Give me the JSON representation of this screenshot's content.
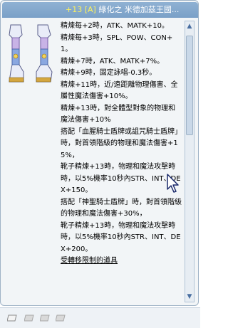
{
  "title": {
    "prefix": "+13 [A] ",
    "name": "綠化之 米德加茲王國..."
  },
  "description": [
    "精煉每+2時，ATK、MATK+10。",
    "精煉每+3時，SPL、POW、CON+1。",
    "精煉+7時，ATK、MATK+7%。",
    "精煉+9時，固定詠唱-0.3秒。",
    "精煉+11時，近/遠距離物理傷害、全屬性魔法傷害+10%。",
    "精煉+13時，對全體型對象的物理和魔法傷害+10%",
    "搭配「血腥騎士盾牌或詛咒騎士盾牌」時，對首領階級的物理和魔法傷害+15%，",
    "靴子精煉+13時，物理和魔法攻擊時時，以5%機率10秒內STR、INT、DEX+150。",
    "搭配「神聖騎士盾牌」時，對首領階級的物理和魔法傷害+30%，",
    "靴子精煉+13時，物理和魔法攻擊時時，以5%機率10秒內STR、INT、DEX+200。"
  ],
  "restriction": "受轉移限制的道具",
  "scroll": {
    "up": "▲",
    "down": "▼"
  },
  "colors": {
    "title_highlight": "#fff35a",
    "title_bg": "#7aa0c7"
  }
}
